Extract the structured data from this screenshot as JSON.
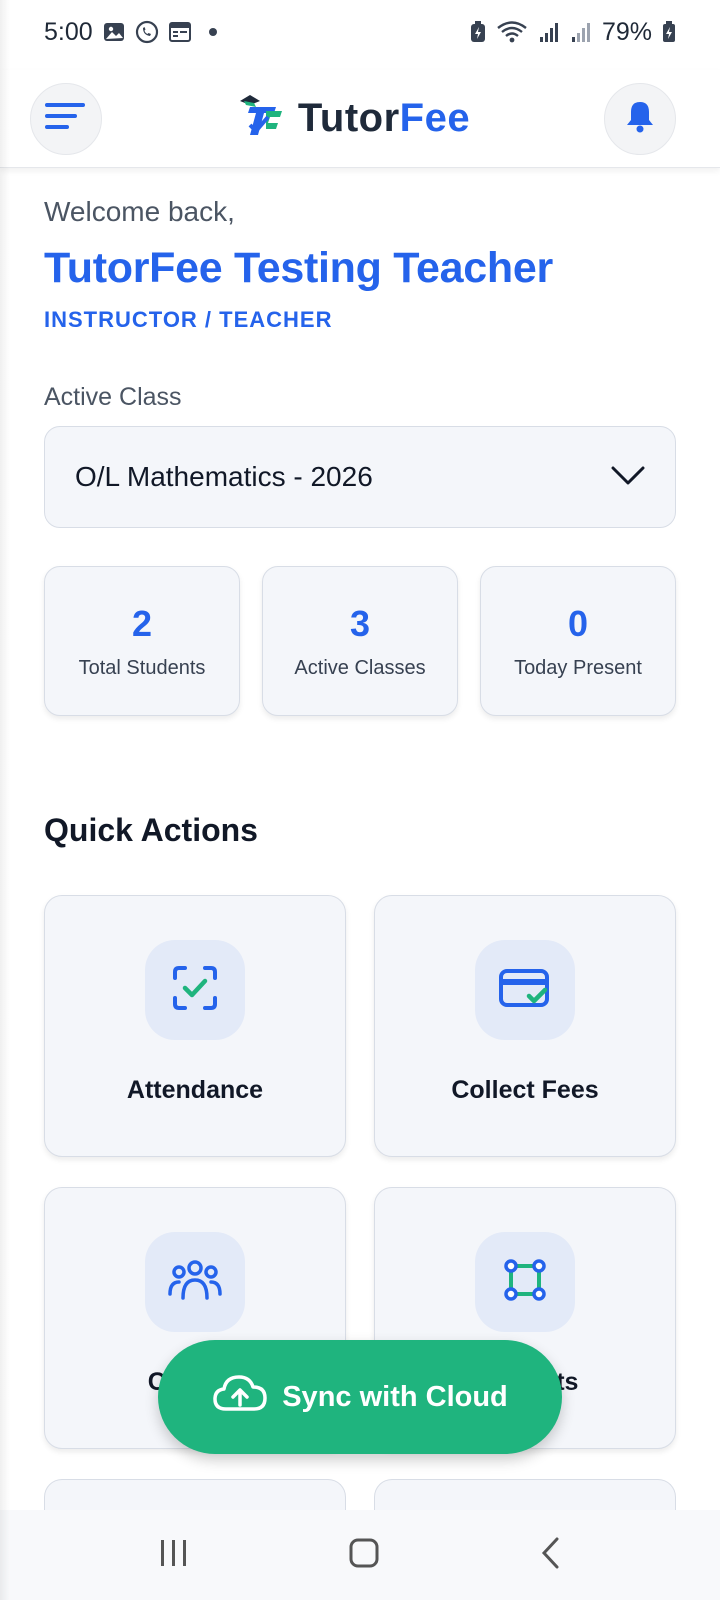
{
  "status_bar": {
    "time": "5:00",
    "battery": "79%",
    "icons_left": [
      "gallery-icon",
      "whatsapp-icon",
      "calendar-icon",
      "notification-dot"
    ],
    "icons_right": [
      "battery-saver-icon",
      "wifi-icon",
      "signal-icon",
      "signal-icon-2",
      "battery-icon"
    ]
  },
  "header": {
    "brand_part1": "Tutor",
    "brand_part2": "Fee",
    "menu_icon": "menu-icon",
    "bell_icon": "bell-icon"
  },
  "welcome": {
    "greeting": "Welcome back,",
    "name": "TutorFee Testing Teacher",
    "role": "INSTRUCTOR / TEACHER"
  },
  "active_class": {
    "label": "Active Class",
    "selected": "O/L Mathematics - 2026"
  },
  "stats": [
    {
      "value": "2",
      "label": "Total Students"
    },
    {
      "value": "3",
      "label": "Active Classes"
    },
    {
      "value": "0",
      "label": "Today Present"
    }
  ],
  "quick_actions": {
    "title": "Quick Actions",
    "items": [
      {
        "label": "Attendance",
        "icon": "scan-check-icon"
      },
      {
        "label": "Collect Fees",
        "icon": "card-check-icon"
      },
      {
        "label": "Classes",
        "icon": "users-icon"
      },
      {
        "label": "Students",
        "icon": "nodes-icon"
      }
    ]
  },
  "fab": {
    "label": "Sync with Cloud",
    "icon": "cloud-upload-icon"
  },
  "colors": {
    "primary": "#2563eb",
    "accent": "#1fb47e"
  }
}
